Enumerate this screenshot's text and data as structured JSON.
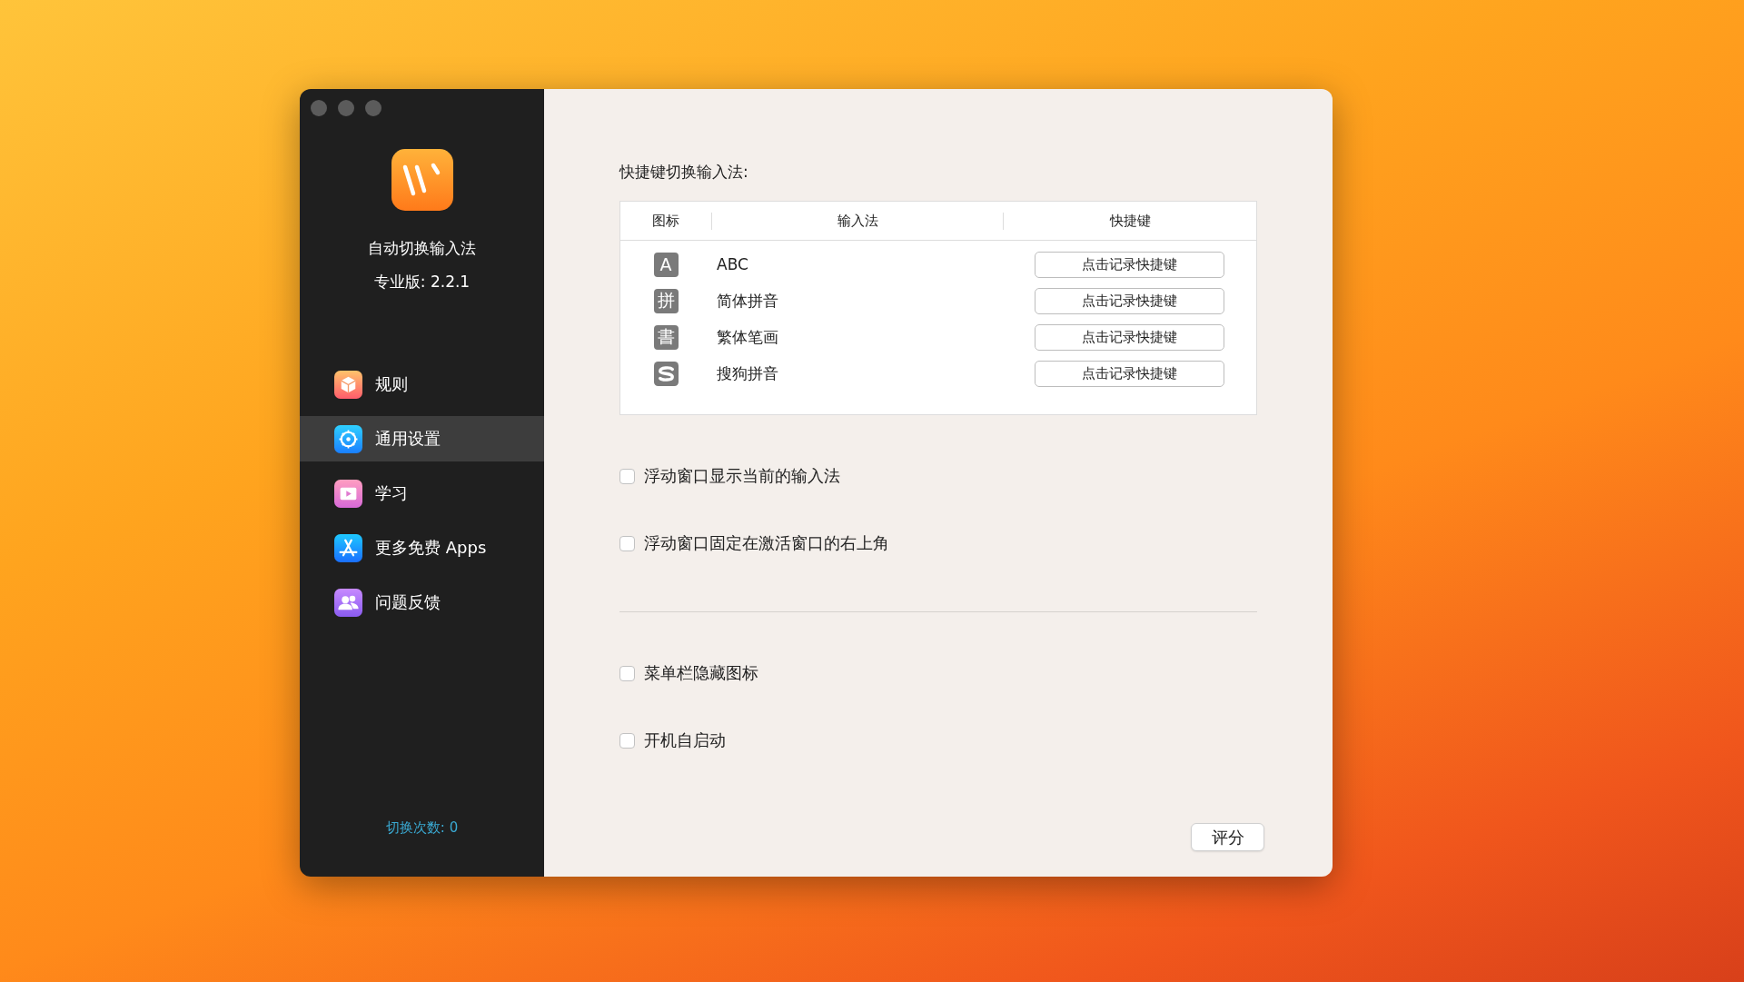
{
  "sidebar": {
    "app_name": "自动切换输入法",
    "version": "专业版: 2.2.1",
    "items": [
      {
        "label": "规则",
        "kind": "rules",
        "selected": false
      },
      {
        "label": "通用设置",
        "kind": "settings",
        "selected": true
      },
      {
        "label": "学习",
        "kind": "video",
        "selected": false
      },
      {
        "label": "更多免费 Apps",
        "kind": "appstore",
        "selected": false
      },
      {
        "label": "问题反馈",
        "kind": "people",
        "selected": false
      }
    ],
    "footer": "切换次数: 0"
  },
  "shortcuts": {
    "title": "快捷键切换输入法:",
    "columns": [
      "图标",
      "输入法",
      "快捷键"
    ],
    "rows": [
      {
        "kind": "glyph",
        "glyph": "A",
        "name": "ABC",
        "button": "点击记录快捷键"
      },
      {
        "kind": "glyph",
        "glyph": "拼",
        "name": "简体拼音",
        "button": "点击记录快捷键"
      },
      {
        "kind": "glyph",
        "glyph": "書",
        "name": "繁体笔画",
        "button": "点击记录快捷键"
      },
      {
        "kind": "sogou",
        "name": "搜狗拼音",
        "button": "点击记录快捷键"
      }
    ]
  },
  "options_top": [
    {
      "label": "浮动窗口显示当前的输入法",
      "checked": false
    },
    {
      "label": "浮动窗口固定在激活窗口的右上角",
      "checked": false
    }
  ],
  "options_bottom": [
    {
      "label": "菜单栏隐藏图标",
      "checked": false
    },
    {
      "label": "开机自启动",
      "checked": false
    }
  ],
  "rate_button": "评分"
}
